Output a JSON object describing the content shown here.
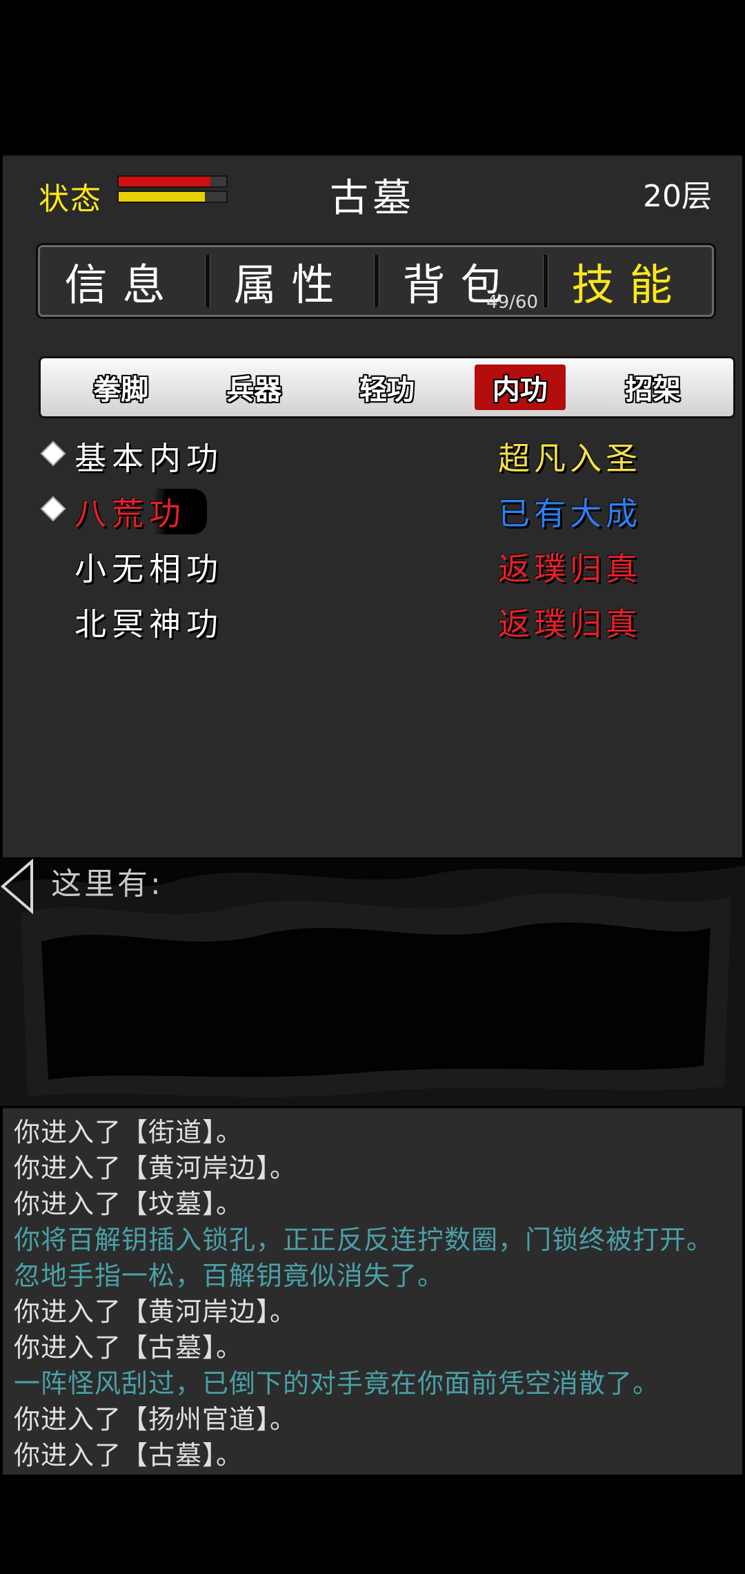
{
  "header": {
    "status_label": "状态",
    "hp_fraction": 0.85,
    "mp_fraction": 0.8,
    "location": "古墓",
    "floor": "20层"
  },
  "tabs": [
    {
      "label": "信息",
      "active": false
    },
    {
      "label": "属性",
      "active": false
    },
    {
      "label": "背包",
      "active": false,
      "count": "49/60"
    },
    {
      "label": "技能",
      "active": true
    }
  ],
  "subtabs": [
    {
      "label": "拳脚",
      "active": false
    },
    {
      "label": "兵器",
      "active": false
    },
    {
      "label": "轻功",
      "active": false
    },
    {
      "label": "内功",
      "active": true
    },
    {
      "label": "招架",
      "active": false
    }
  ],
  "skills": [
    {
      "name": "基本内功",
      "level": "超凡入圣",
      "marked": true,
      "name_color": "#ffffff",
      "level_color": "#f4e04a"
    },
    {
      "name": "八荒功",
      "level": "已有大成",
      "marked": true,
      "name_color": "#e8202a",
      "level_color": "#2f7ff0"
    },
    {
      "name": "小无相功",
      "level": "返璞归真",
      "marked": false,
      "name_color": "#ffffff",
      "level_color": "#e8202a"
    },
    {
      "name": "北冥神功",
      "level": "返璞归真",
      "marked": false,
      "name_color": "#ffffff",
      "level_color": "#e8202a"
    }
  ],
  "scene": {
    "here_label": "这里有:"
  },
  "log": [
    {
      "text": "你进入了【街道】。",
      "special": false
    },
    {
      "text": "你进入了【黄河岸边】。",
      "special": false
    },
    {
      "text": "你进入了【坟墓】。",
      "special": false
    },
    {
      "text": "你将百解钥插入锁孔，正正反反连拧数圈，门锁终被打开。忽地手指一松，百解钥竟似消失了。",
      "special": true
    },
    {
      "text": "你进入了【黄河岸边】。",
      "special": false
    },
    {
      "text": "你进入了【古墓】。",
      "special": false
    },
    {
      "text": "一阵怪风刮过，已倒下的对手竟在你面前凭空消散了。",
      "special": true
    },
    {
      "text": "你进入了【扬州官道】。",
      "special": false
    },
    {
      "text": "你进入了【古墓】。",
      "special": false
    }
  ],
  "colors": {
    "accent_yellow": "#ffe81a",
    "hp_red": "#d01010",
    "mp_yellow": "#e8d000",
    "active_subtab": "#b40d0d",
    "log_special": "#4aa0a8"
  }
}
